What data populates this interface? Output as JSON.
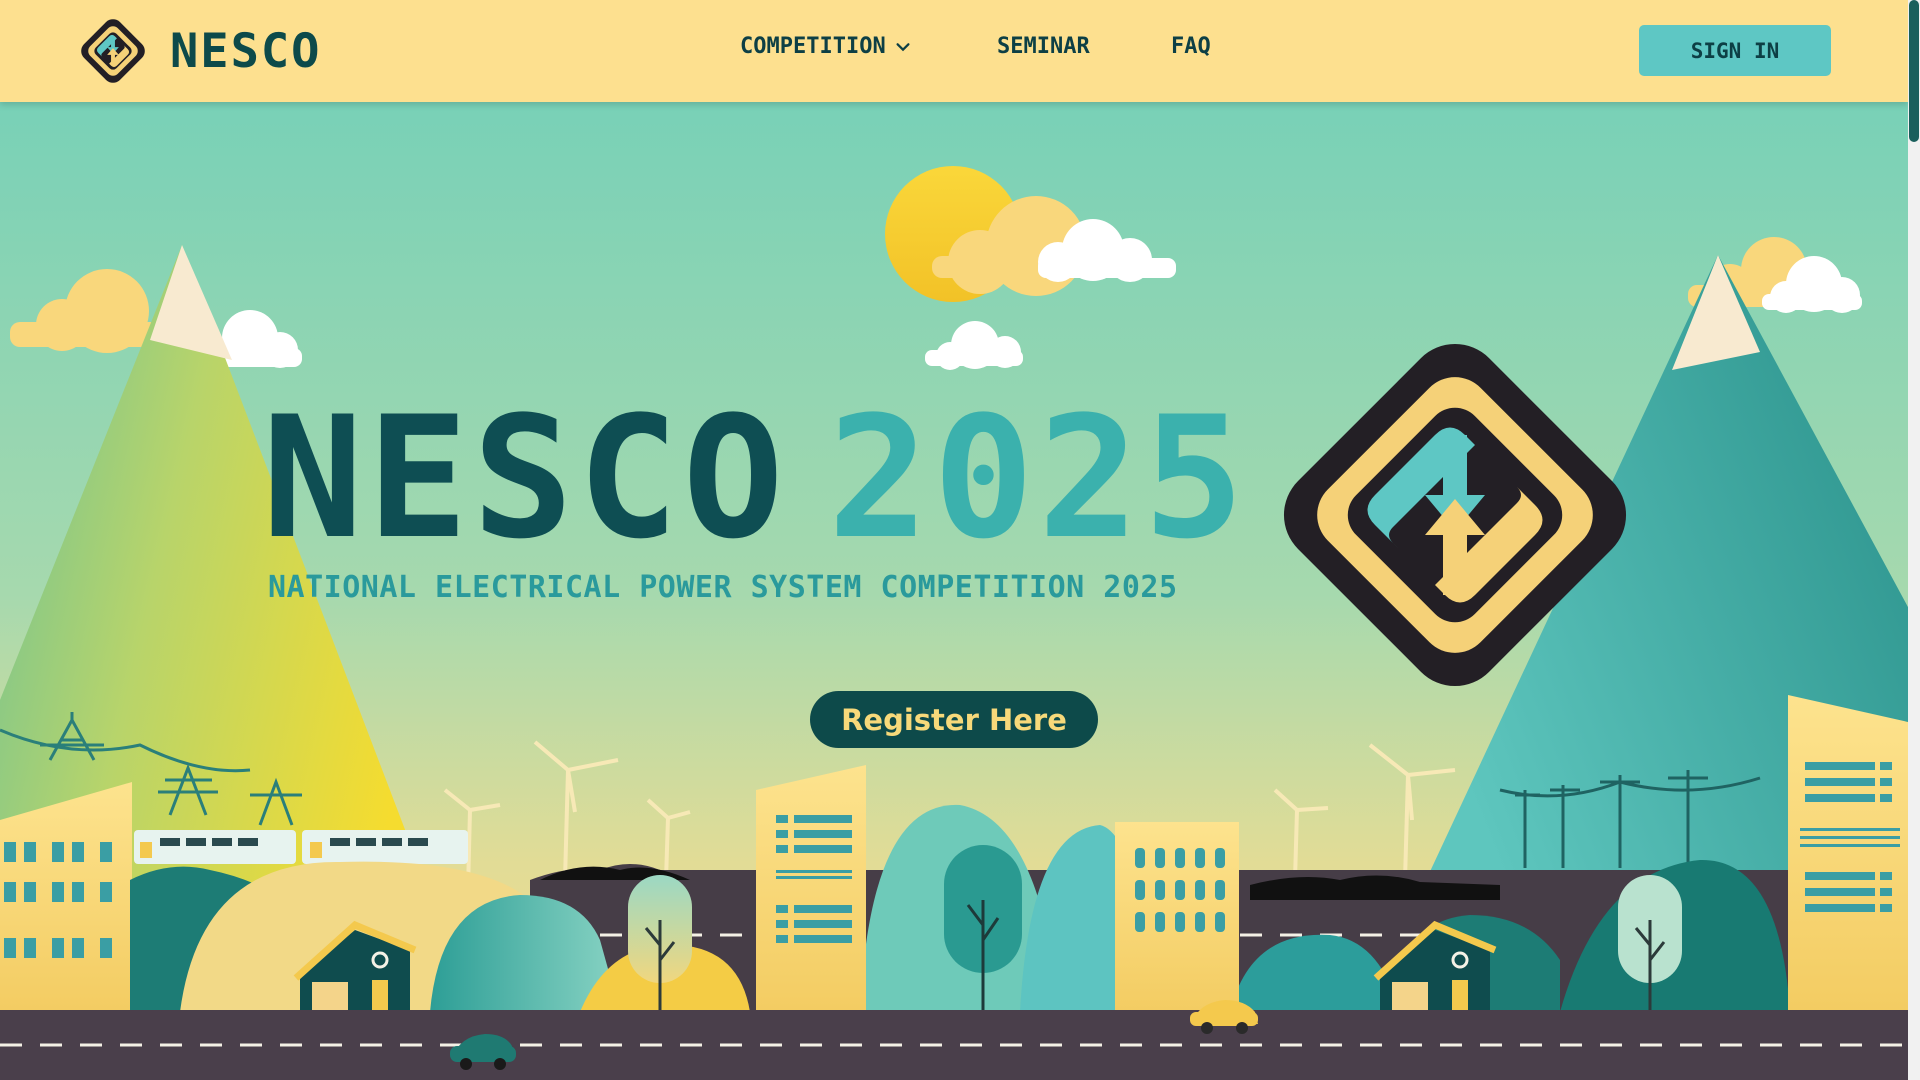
{
  "nav": {
    "brand": "NESCO",
    "items": [
      {
        "label": "COMPETITION"
      },
      {
        "label": "SEMINAR"
      },
      {
        "label": "FAQ"
      }
    ],
    "signin_label": "SIGN IN"
  },
  "hero": {
    "title_part1": "NESCO",
    "title_part2": "2025",
    "subtitle": "NATIONAL ELECTRICAL POWER SYSTEM COMPETITION 2025",
    "register_label": "Register Here"
  },
  "colors": {
    "navbar": "#fde08f",
    "sky": "#74cfb7",
    "primary_dark": "#0d4a4a",
    "teal": "#3bb1ad",
    "accent_yellow": "#f7d97a"
  },
  "icons": [
    "logo-icon",
    "chevron-down-icon"
  ]
}
